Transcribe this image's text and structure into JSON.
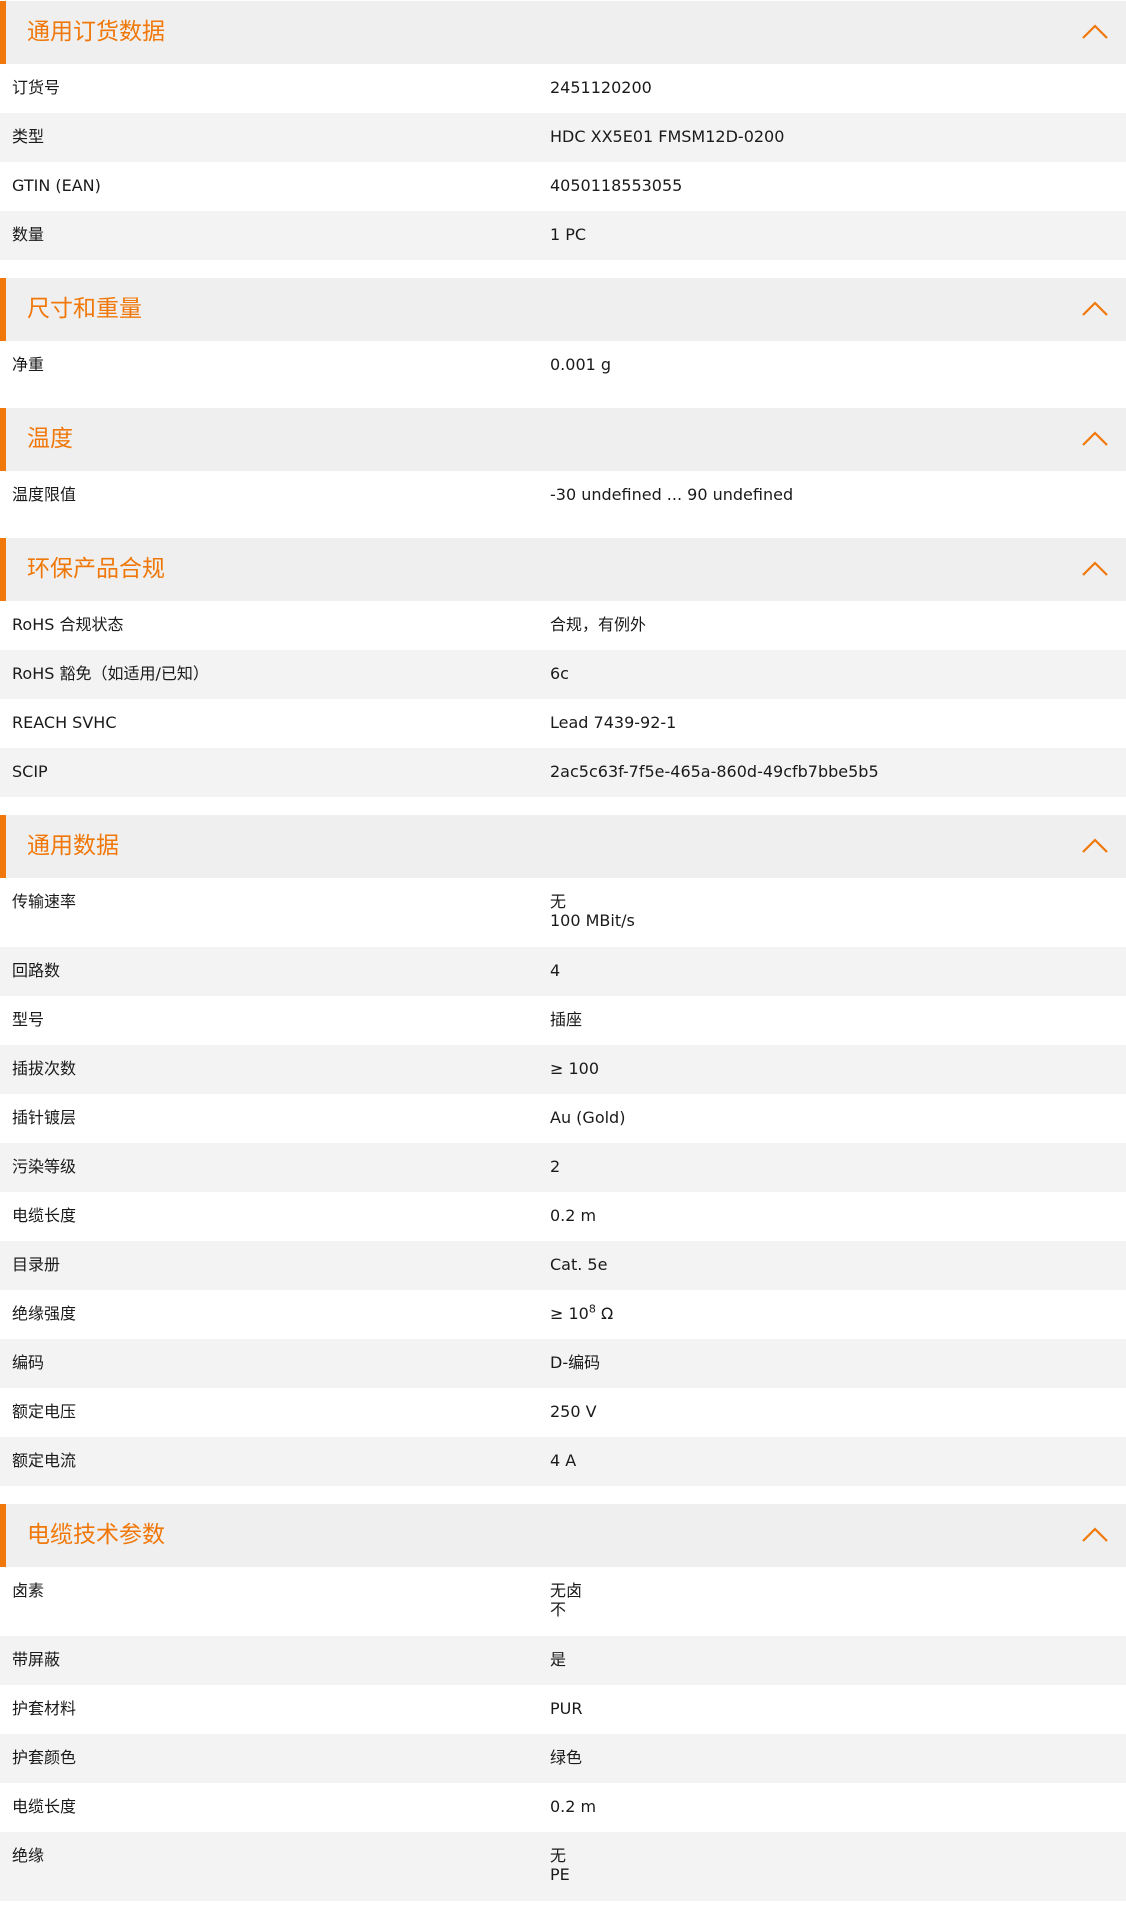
{
  "accent_color": "#f0780a",
  "icons": {
    "collapse": "chevron-up-icon"
  },
  "sections": [
    {
      "id": "general-ordering",
      "title": "通用订货数据",
      "rows": [
        {
          "label": "订货号",
          "value": "2451120200"
        },
        {
          "label": "类型",
          "value": "HDC XX5E01 FMSM12D-0200"
        },
        {
          "label": "GTIN (EAN)",
          "value": "4050118553055"
        },
        {
          "label": "数量",
          "value": "1  PC"
        }
      ]
    },
    {
      "id": "dimensions-weight",
      "title": "尺寸和重量",
      "rows": [
        {
          "label": "净重",
          "value": "0.001  g"
        }
      ]
    },
    {
      "id": "temperature",
      "title": "温度",
      "rows": [
        {
          "label": "温度限值",
          "value": "-30 undefined ... 90 undefined"
        }
      ]
    },
    {
      "id": "environmental-compliance",
      "title": "环保产品合规",
      "rows": [
        {
          "label": "RoHS 合规状态",
          "value": "合规，有例外"
        },
        {
          "label": "RoHS 豁免（如适用/已知）",
          "value": "6c"
        },
        {
          "label": "REACH SVHC",
          "value": "Lead 7439-92-1"
        },
        {
          "label": "SCIP",
          "value": "2ac5c63f-7f5e-465a-860d-49cfb7bbe5b5"
        }
      ]
    },
    {
      "id": "general-data",
      "title": "通用数据",
      "rows": [
        {
          "label": "传输速率",
          "value": "无\n100 MBit/s"
        },
        {
          "label": "回路数",
          "value": "4"
        },
        {
          "label": "型号",
          "value": "插座"
        },
        {
          "label": "插拔次数",
          "value": "≥ 100"
        },
        {
          "label": "插针镀层",
          "value": "Au (Gold)"
        },
        {
          "label": "污染等级",
          "value": "2"
        },
        {
          "label": "电缆长度",
          "value": "0.2  m"
        },
        {
          "label": "目录册",
          "value": "Cat. 5e"
        },
        {
          "label": "绝缘强度",
          "value": "≥ 10",
          "sup": "8",
          "suffix": " Ω"
        },
        {
          "label": "编码",
          "value": "D-编码"
        },
        {
          "label": "额定电压",
          "value": "250  V"
        },
        {
          "label": "额定电流",
          "value": "4  A"
        }
      ]
    },
    {
      "id": "cable-technical",
      "title": "电缆技术参数",
      "rows": [
        {
          "label": "卤素",
          "value": "无卤\n不"
        },
        {
          "label": "带屏蔽",
          "value": "是"
        },
        {
          "label": "护套材料",
          "value": "PUR"
        },
        {
          "label": "护套颜色",
          "value": "绿色"
        },
        {
          "label": "电缆长度",
          "value": "0.2  m"
        },
        {
          "label": "绝缘",
          "value": "无\nPE"
        }
      ]
    }
  ]
}
